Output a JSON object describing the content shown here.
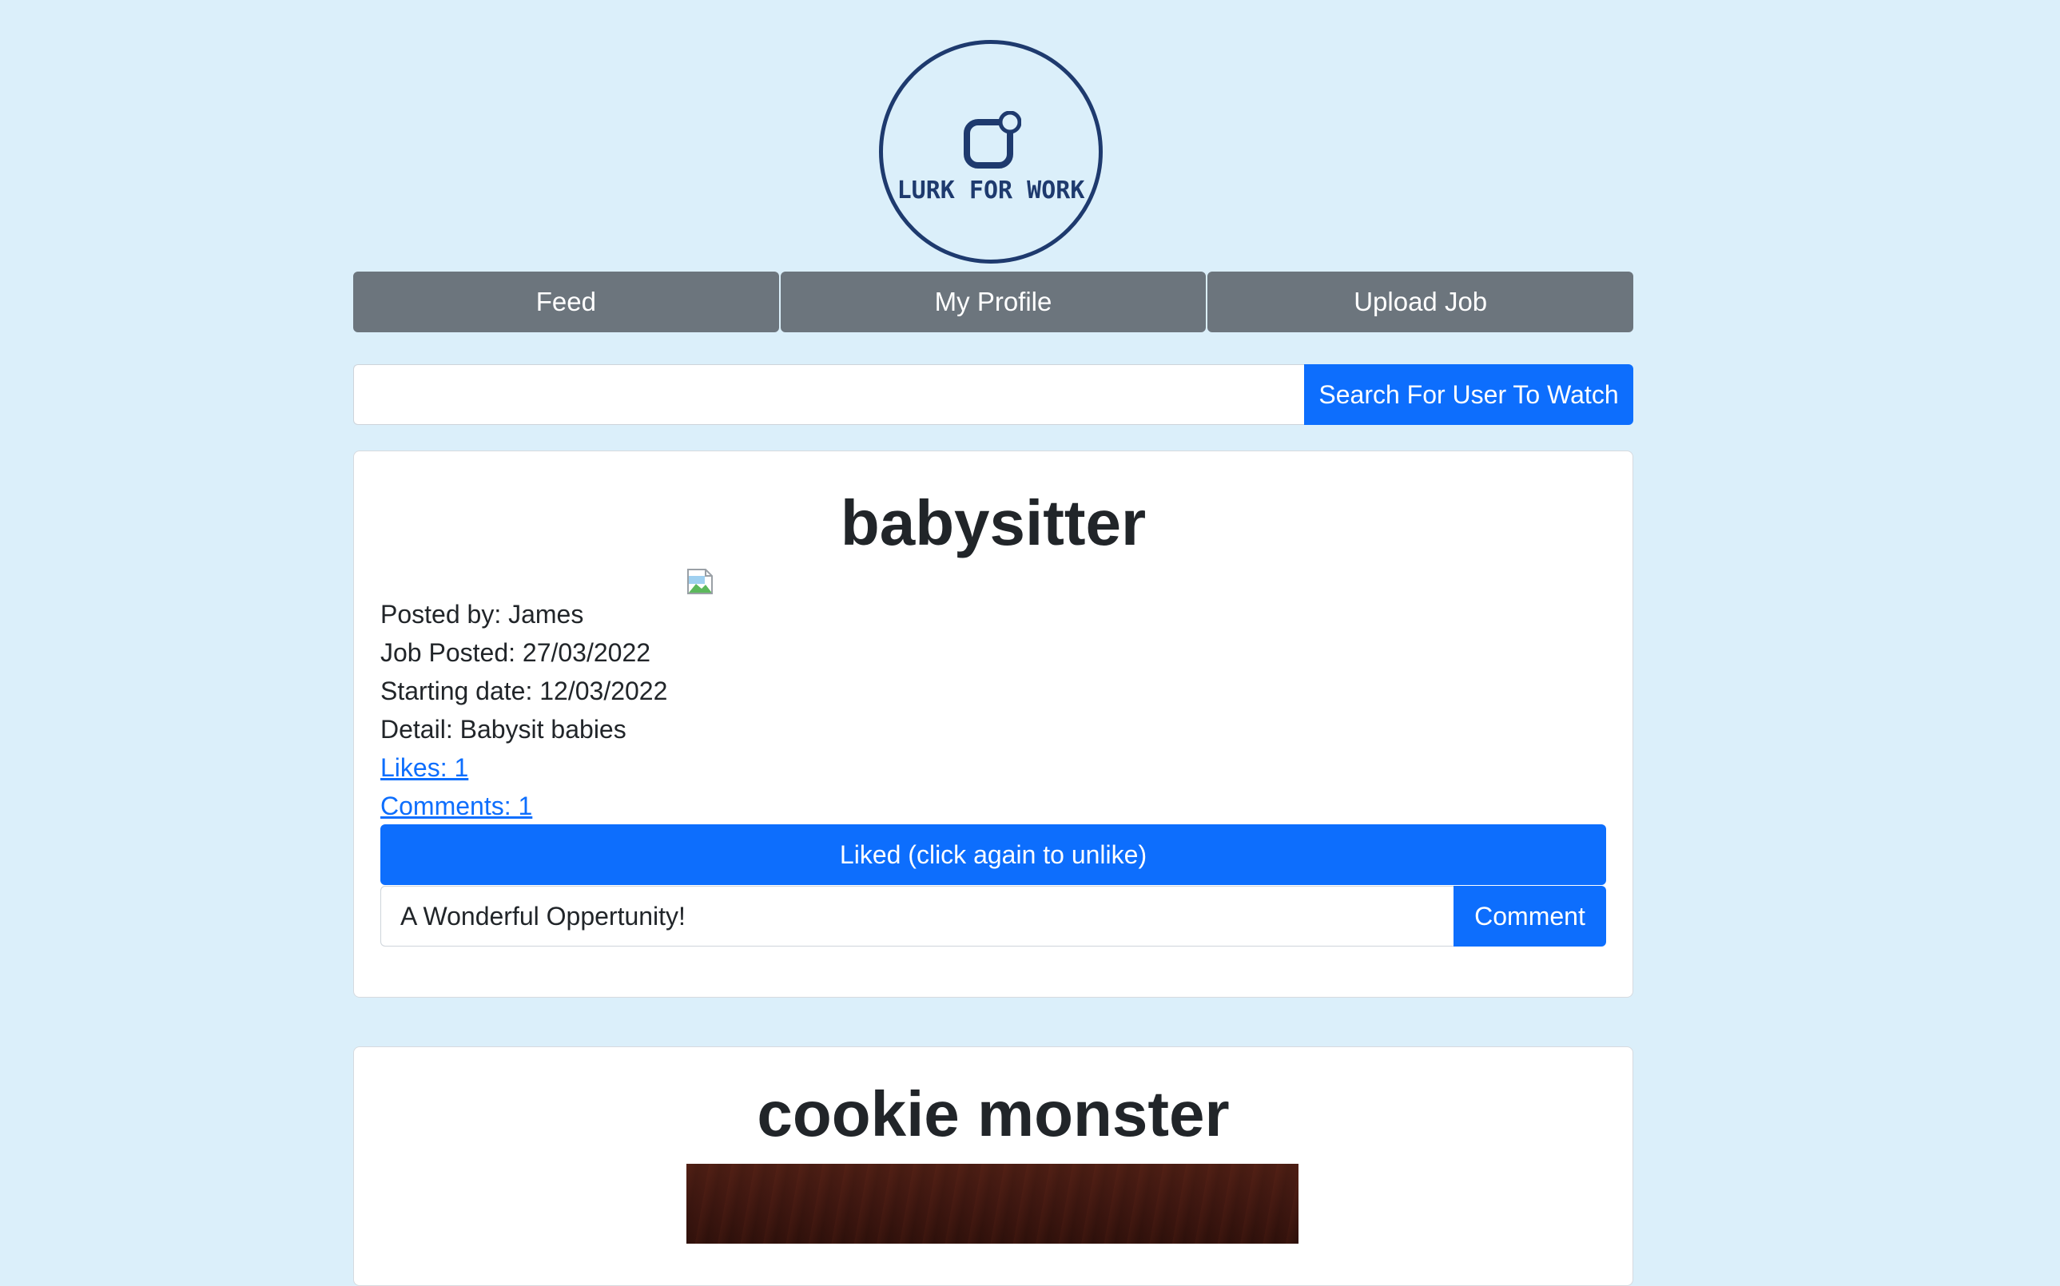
{
  "logo": {
    "text": "LURK FOR WORK"
  },
  "nav": {
    "items": [
      {
        "label": "Feed"
      },
      {
        "label": "My Profile"
      },
      {
        "label": "Upload Job"
      }
    ]
  },
  "search": {
    "value": "",
    "button_label": "Search For User To Watch"
  },
  "feed": {
    "posts": [
      {
        "title": "babysitter",
        "posted_by": "Posted by: James",
        "job_posted": "Job Posted: 27/03/2022",
        "starting_date": "Starting date: 12/03/2022",
        "detail": "Detail: Babysit babies",
        "likes": "Likes: 1",
        "comments": "Comments: 1",
        "like_button": "Liked (click again to unlike)",
        "comment_value": "A Wonderful Oppertunity!",
        "comment_button": "Comment"
      },
      {
        "title": "cookie monster"
      }
    ]
  },
  "colors": {
    "background": "#dbeffa",
    "primary": "#0d6efd",
    "secondary": "#6c757d",
    "logo": "#1e3a6e"
  }
}
